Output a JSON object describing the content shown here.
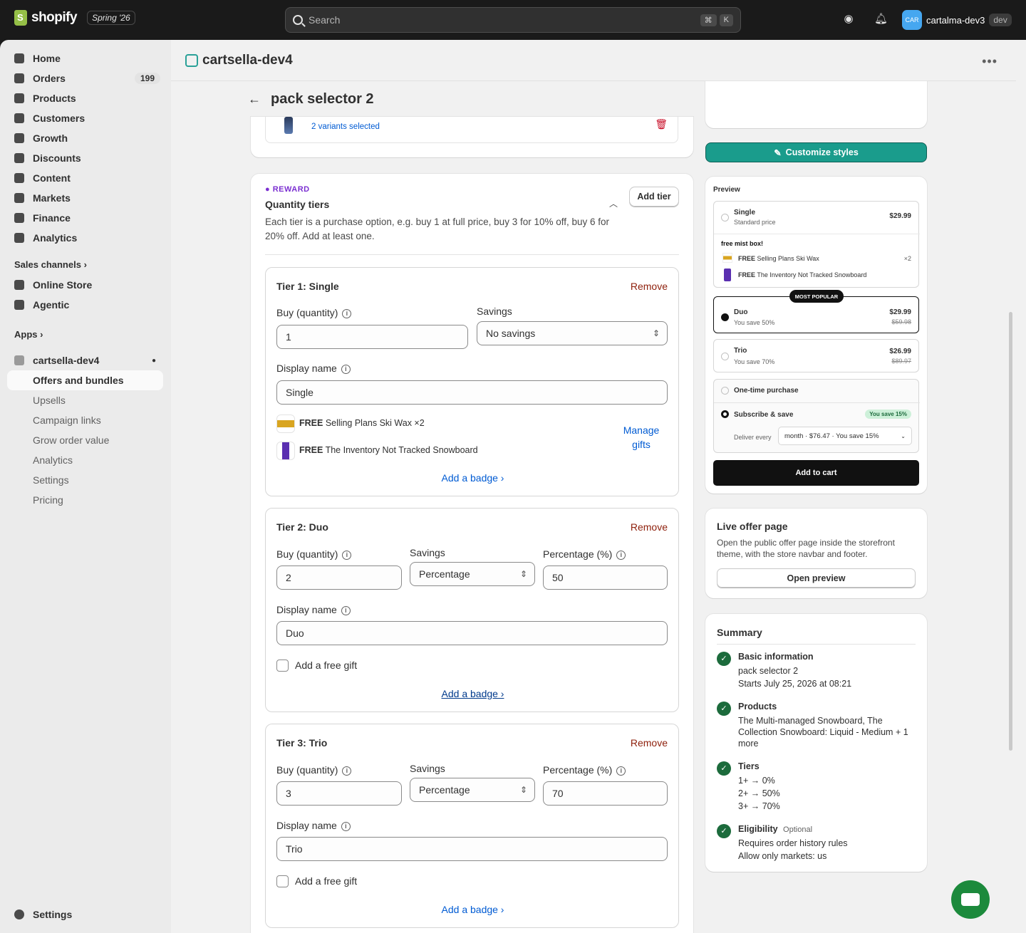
{
  "topbar": {
    "logo_text": "shopify",
    "edition": "Spring '26",
    "search_placeholder": "Search",
    "kbd1": "⌘",
    "kbd2": "K",
    "avatar_text": "CAR",
    "account_name": "cartalma-dev3",
    "account_tag": "dev"
  },
  "sidebar": {
    "items": [
      {
        "label": "Home"
      },
      {
        "label": "Orders",
        "badge": "199"
      },
      {
        "label": "Products"
      },
      {
        "label": "Customers"
      },
      {
        "label": "Growth"
      },
      {
        "label": "Discounts"
      },
      {
        "label": "Content"
      },
      {
        "label": "Markets"
      },
      {
        "label": "Finance"
      },
      {
        "label": "Analytics"
      }
    ],
    "sales_channels": "Sales channels",
    "channels": [
      {
        "label": "Online Store"
      },
      {
        "label": "Agentic"
      }
    ],
    "apps": "Apps",
    "app_name": "cartsella-dev4",
    "app_sub": [
      "Offers and bundles",
      "Upsells",
      "Campaign links",
      "Grow order value",
      "Analytics",
      "Settings",
      "Pricing"
    ],
    "settings": "Settings"
  },
  "app_header": {
    "title": "cartsella-dev4"
  },
  "page": {
    "title": "pack selector 2"
  },
  "top_card": {
    "variants": "2 variants selected"
  },
  "reward": {
    "eyebrow": "REWARD",
    "title": "Quantity tiers",
    "desc1": "Each tier is a purchase option, e.g. buy 1 at full price, buy 3 for 10% off, buy 6 for",
    "desc2": "20% off. Add at least one.",
    "add_tier": "Add tier"
  },
  "labels": {
    "buy_qty": "Buy (quantity)",
    "savings": "Savings",
    "percentage": "Percentage (%)",
    "display_name": "Display name",
    "remove": "Remove",
    "add_badge": "Add a badge ›",
    "add_free_gift": "Add a free gift",
    "free": "FREE",
    "manage": "Manage",
    "gifts": "gifts"
  },
  "tiers": [
    {
      "title": "Tier 1: Single",
      "qty": "1",
      "savings": "No savings",
      "name": "Single",
      "gifts": [
        {
          "name": "Selling Plans Ski Wax ×2"
        },
        {
          "name": "The Inventory Not Tracked Snowboard"
        }
      ]
    },
    {
      "title": "Tier 2: Duo",
      "qty": "2",
      "savings": "Percentage",
      "pct": "50",
      "name": "Duo"
    },
    {
      "title": "Tier 3: Trio",
      "qty": "3",
      "savings": "Percentage",
      "pct": "70",
      "name": "Trio"
    }
  ],
  "customize": {
    "label": "Customize styles"
  },
  "preview": {
    "heading": "Preview",
    "single": {
      "name": "Single",
      "sub": "Standard price",
      "price": "$29.99"
    },
    "gift_heading": "free mist box!",
    "gifts": [
      {
        "free": "FREE",
        "name": "Selling Plans Ski Wax",
        "qty": "×2"
      },
      {
        "free": "FREE",
        "name": "The Inventory Not Tracked Snowboard"
      }
    ],
    "popular": "MOST POPULAR",
    "duo": {
      "name": "Duo",
      "sub": "You save 50%",
      "price": "$29.99",
      "compare": "$59.98"
    },
    "trio": {
      "name": "Trio",
      "sub": "You save 70%",
      "price": "$26.99",
      "compare": "$89.97"
    },
    "one_time": "One-time purchase",
    "subscribe": "Subscribe & save",
    "save_badge": "You save 15%",
    "deliver_every": "Deliver every",
    "deliver_value": "month · $76.47 · You save 15%",
    "add_to_cart": "Add to cart"
  },
  "live": {
    "title": "Live offer page",
    "desc1": "Open the public offer page inside the storefront",
    "desc2": "theme, with the store navbar and footer.",
    "button": "Open preview"
  },
  "summary": {
    "title": "Summary",
    "sections": [
      {
        "title": "Basic information",
        "lines": [
          "pack selector 2",
          "Starts July 25, 2026 at 08:21"
        ]
      },
      {
        "title": "Products",
        "lines": [
          "The Multi-managed Snowboard, The",
          "Collection Snowboard: Liquid - Medium + 1",
          "more"
        ]
      },
      {
        "title": "Tiers",
        "lines": [
          "1+ → 0%",
          "2+ → 50%",
          "3+ → 70%"
        ]
      },
      {
        "title": "Eligibility",
        "optional": "Optional",
        "lines": [
          "Requires order history rules",
          "Allow only markets: us"
        ]
      }
    ]
  },
  "colors": {
    "accent_teal": "#1a9c8c",
    "link": "#005bd3",
    "danger": "#8e1f0b",
    "success": "#1c6b3c"
  }
}
